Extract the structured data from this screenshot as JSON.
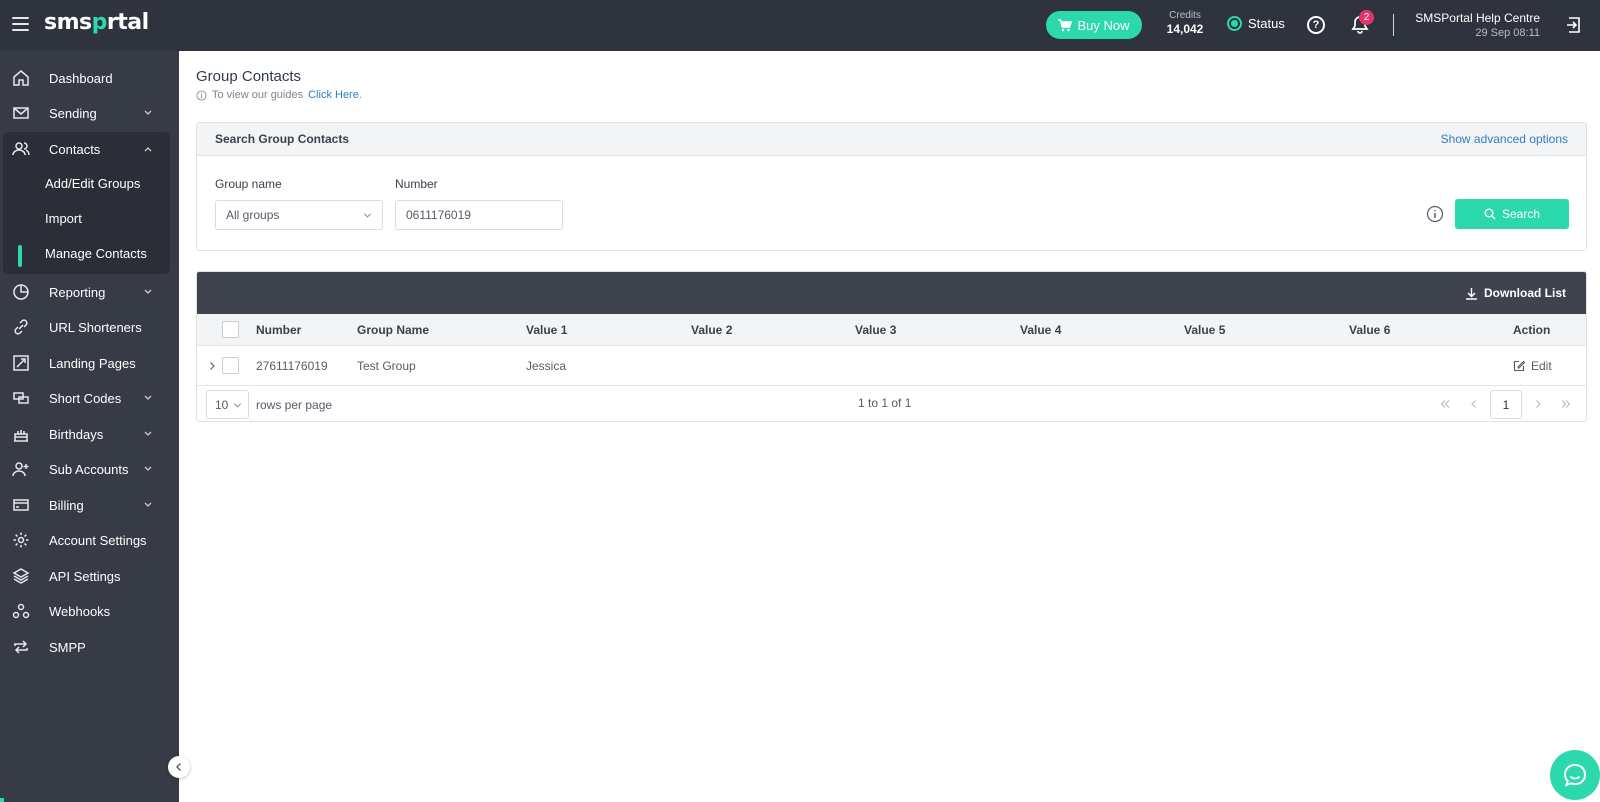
{
  "header": {
    "logo_prefix": "sms",
    "logo_o": "p",
    "logo_suffix": "rtal",
    "buy_now": "Buy Now",
    "credits_label": "Credits",
    "credits_value": "14,042",
    "status_label": "Status",
    "notification_count": "2",
    "user_name": "SMSPortal Help Centre",
    "datetime": "29 Sep 08:11"
  },
  "sidebar": {
    "items": [
      {
        "label": "Dashboard",
        "icon": "home-icon"
      },
      {
        "label": "Sending",
        "icon": "envelope-icon",
        "expandable": true
      },
      {
        "label": "Contacts",
        "icon": "users-icon",
        "expandable": true,
        "expanded": true
      },
      {
        "label": "Reporting",
        "icon": "pie-chart-icon",
        "expandable": true
      },
      {
        "label": "URL Shorteners",
        "icon": "link-icon"
      },
      {
        "label": "Landing Pages",
        "icon": "landing-page-icon"
      },
      {
        "label": "Short Codes",
        "icon": "short-code-icon",
        "expandable": true
      },
      {
        "label": "Birthdays",
        "icon": "cake-icon",
        "expandable": true
      },
      {
        "label": "Sub Accounts",
        "icon": "user-plus-icon",
        "expandable": true
      },
      {
        "label": "Billing",
        "icon": "credit-card-icon",
        "expandable": true
      },
      {
        "label": "Account Settings",
        "icon": "gear-icon"
      },
      {
        "label": "API Settings",
        "icon": "layers-icon"
      },
      {
        "label": "Webhooks",
        "icon": "webhook-icon"
      },
      {
        "label": "SMPP",
        "icon": "repeat-icon"
      }
    ],
    "contacts_sub": [
      {
        "label": "Add/Edit Groups"
      },
      {
        "label": "Import"
      },
      {
        "label": "Manage Contacts",
        "active": true
      }
    ]
  },
  "page": {
    "title": "Group Contacts",
    "guide_text": "To view our guides",
    "guide_link": "Click Here",
    "guide_dot": "."
  },
  "search": {
    "title": "Search Group Contacts",
    "advanced": "Show advanced options",
    "group_label": "Group name",
    "group_value": "All groups",
    "number_label": "Number",
    "number_value": "0611176019",
    "button": "Search"
  },
  "table": {
    "download": "Download List",
    "columns": [
      "Number",
      "Group Name",
      "Value 1",
      "Value 2",
      "Value 3",
      "Value 4",
      "Value 5",
      "Value 6",
      "Action"
    ],
    "rows": [
      {
        "number": "27611176019",
        "group": "Test Group",
        "value1": "Jessica",
        "action": "Edit"
      }
    ],
    "rows_per_page": "10",
    "rows_per_page_label": "rows per page",
    "range": "1 to 1 of 1",
    "page": "1"
  },
  "colors": {
    "accent": "#2bd9ad",
    "topbar": "#2f333d",
    "sidebar": "#373b46",
    "link": "#2d7fc4",
    "badge": "#e4336a"
  }
}
